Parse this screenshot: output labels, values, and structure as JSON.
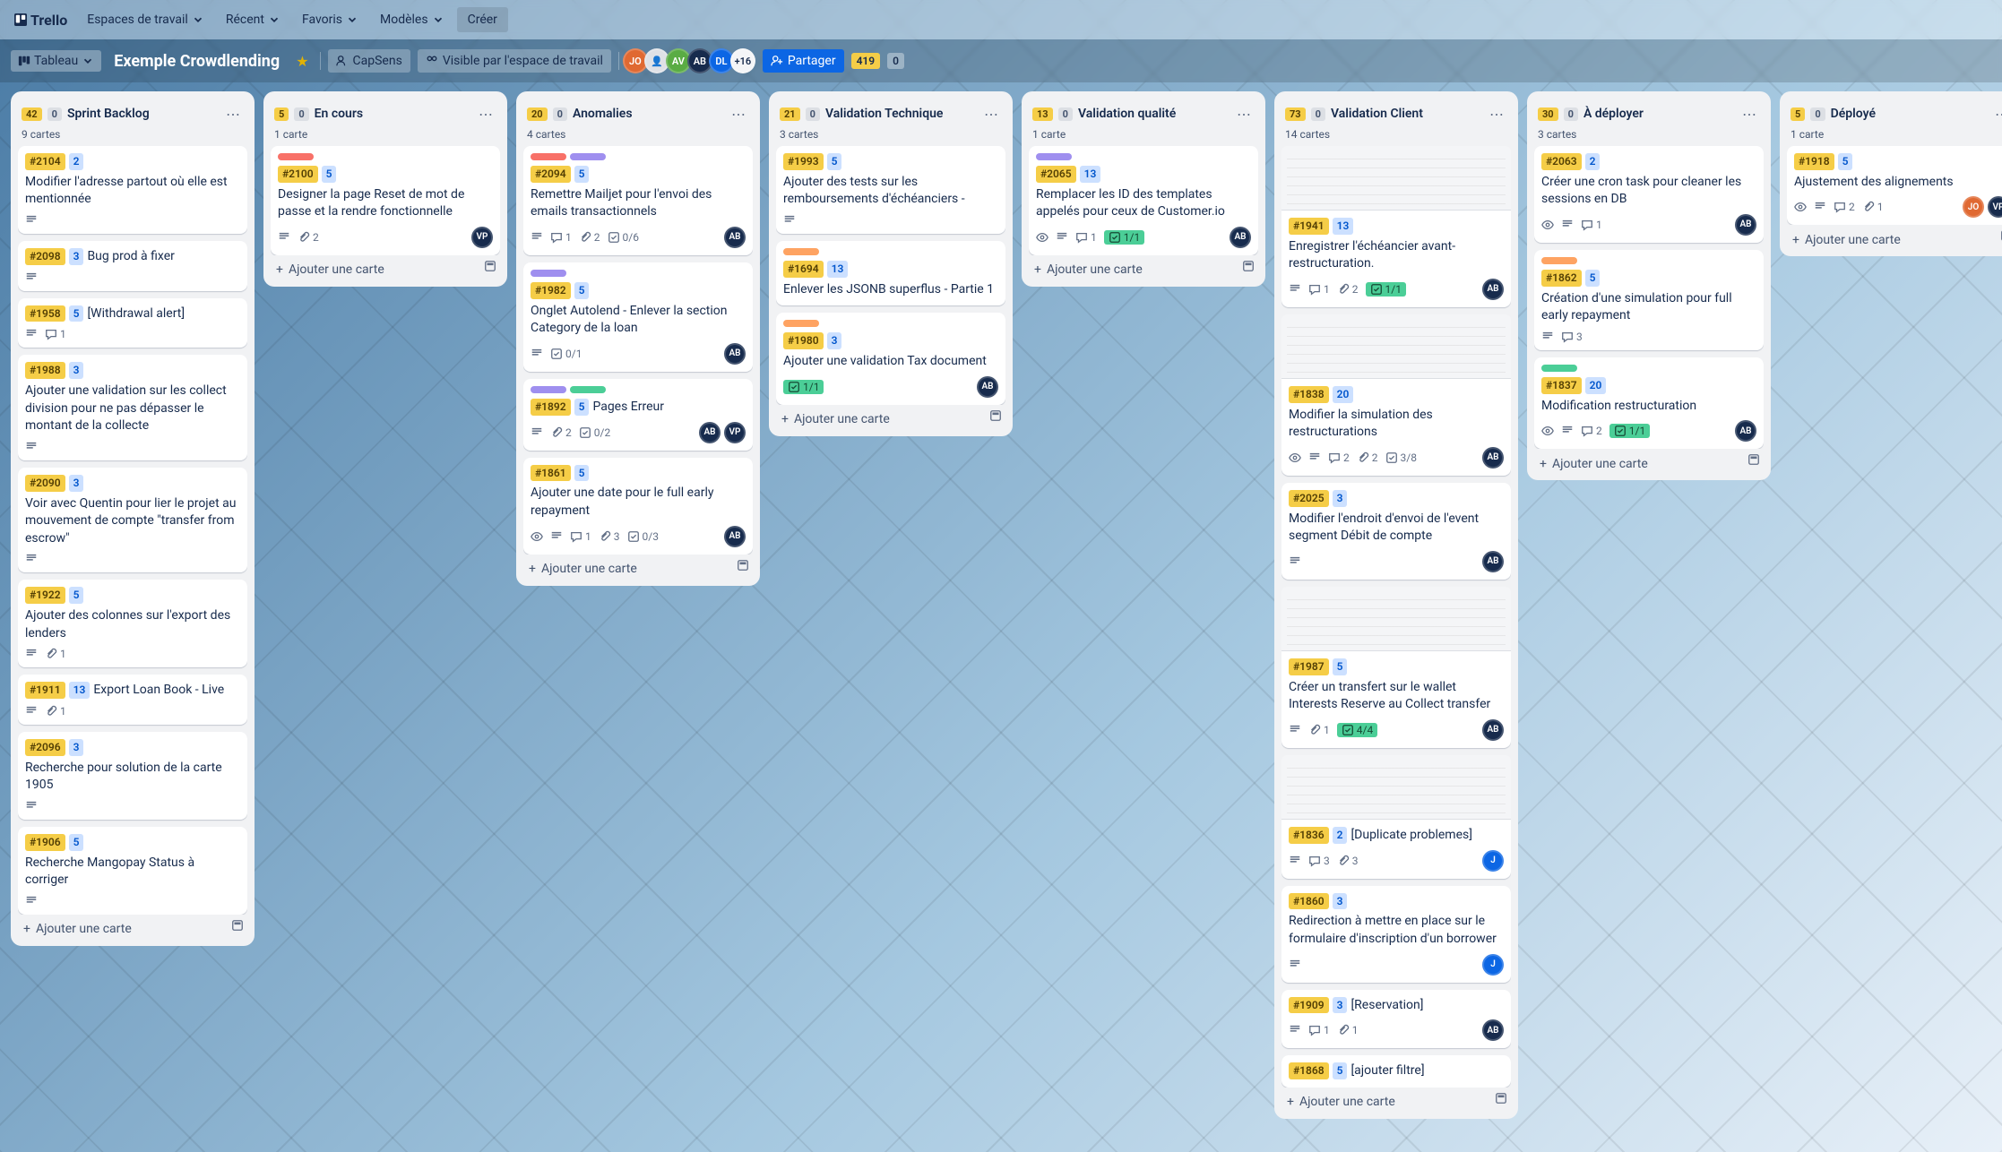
{
  "nav": {
    "brand": "Trello",
    "workspaces": "Espaces de travail",
    "recent": "Récent",
    "favorites": "Favoris",
    "templates": "Modèles",
    "create": "Créer"
  },
  "board_header": {
    "view_label": "Tableau",
    "board_name": "Exemple Crowdlending",
    "workspace_name": "CapSens",
    "visibility": "Visible par l'espace de travail",
    "share": "Partager",
    "avatars_more": "+16",
    "counter1": "419",
    "counter2": "0"
  },
  "add_card_label": "Ajouter une carte",
  "lists": [
    {
      "pill1": "42",
      "pill2": "0",
      "title": "Sprint Backlog",
      "sub": "9 cartes",
      "cards": [
        {
          "id": "#2104",
          "pts": "2",
          "title": "Modifier l'adresse partout où elle est mentionnée",
          "desc": true
        },
        {
          "id": "#2098",
          "pts": "3",
          "title": "Bug prod à fixer",
          "desc": true
        },
        {
          "id": "#1958",
          "pts": "5",
          "title": "[Withdrawal alert]",
          "desc": true,
          "comments": "1"
        },
        {
          "id": "#1988",
          "pts": "3",
          "title": "Ajouter une validation sur les collect division pour ne pas dépasser le montant de la collecte",
          "desc": true
        },
        {
          "id": "#2090",
          "pts": "3",
          "title": "Voir avec Quentin pour lier le projet au mouvement de compte \"transfer from escrow\"",
          "desc": true
        },
        {
          "id": "#1922",
          "pts": "5",
          "title": "Ajouter des colonnes sur l'export des lenders",
          "desc": true,
          "attach": "1"
        },
        {
          "id": "#1911",
          "pts": "13",
          "title": "Export Loan Book - Live",
          "desc": true,
          "attach": "1"
        },
        {
          "id": "#2096",
          "pts": "3",
          "title": "Recherche pour solution de la carte 1905",
          "desc": true
        },
        {
          "id": "#1906",
          "pts": "5",
          "title": "Recherche Mangopay Status à corriger",
          "desc": true
        }
      ]
    },
    {
      "pill1": "5",
      "pill2": "0",
      "title": "En cours",
      "sub": "1 carte",
      "cards": [
        {
          "labels": [
            "red"
          ],
          "id": "#2100",
          "pts": "5",
          "title": "Designer la page Reset de mot de passe et la rendre fonctionnelle",
          "desc": true,
          "attach": "2",
          "avatars": [
            "VP"
          ]
        }
      ]
    },
    {
      "pill1": "20",
      "pill2": "0",
      "title": "Anomalies",
      "sub": "4 cartes",
      "cards": [
        {
          "labels": [
            "red",
            "purple"
          ],
          "id": "#2094",
          "pts": "5",
          "title": "Remettre Mailjet pour l'envoi des emails transactionnels",
          "desc": true,
          "comments": "1",
          "attach": "2",
          "check": "0/6",
          "avatars": [
            "AB"
          ]
        },
        {
          "labels": [
            "purple"
          ],
          "id": "#1982",
          "pts": "5",
          "title": "Onglet Autolend - Enlever la section Category de la loan",
          "desc": true,
          "check": "0/1",
          "avatars": [
            "AB"
          ]
        },
        {
          "labels": [
            "purple",
            "green"
          ],
          "id": "#1892",
          "pts": "5",
          "title": "Pages Erreur",
          "desc": true,
          "attach": "2",
          "check": "0/2",
          "avatars": [
            "AB",
            "VP"
          ]
        },
        {
          "id": "#1861",
          "pts": "5",
          "title": "Ajouter une date pour le full early repayment",
          "watch": true,
          "desc": true,
          "comments": "1",
          "attach": "3",
          "check": "0/3",
          "avatars": [
            "AB"
          ]
        }
      ]
    },
    {
      "pill1": "21",
      "pill2": "0",
      "title": "Validation Technique",
      "sub": "3 cartes",
      "cards": [
        {
          "id": "#1993",
          "pts": "5",
          "title": "Ajouter des tests sur les remboursements d'échéanciers -",
          "desc": true
        },
        {
          "labels": [
            "orange"
          ],
          "id": "#1694",
          "pts": "13",
          "title": "Enlever les JSONB superflus - Partie 1"
        },
        {
          "labels": [
            "orange"
          ],
          "id": "#1980",
          "pts": "3",
          "title": "Ajouter une validation Tax document",
          "check": "1/1",
          "check_done": true,
          "avatars": [
            "AB"
          ]
        }
      ]
    },
    {
      "pill1": "13",
      "pill2": "0",
      "title": "Validation qualité",
      "sub": "1 carte",
      "cards": [
        {
          "labels": [
            "purple"
          ],
          "id": "#2065",
          "pts": "13",
          "title": "Remplacer les ID des templates appelés pour ceux de Customer.io",
          "watch": true,
          "desc": true,
          "comments": "1",
          "check": "1/1",
          "check_done": true,
          "avatars": [
            "AB"
          ]
        }
      ]
    },
    {
      "pill1": "73",
      "pill2": "0",
      "title": "Validation Client",
      "sub": "14 cartes",
      "cards": [
        {
          "cover": true,
          "id": "#1941",
          "pts": "13",
          "title": "Enregistrer l'échéancier avant-restructuration.",
          "desc": true,
          "comments": "1",
          "attach": "2",
          "check": "1/1",
          "check_done": true,
          "avatars": [
            "AB"
          ]
        },
        {
          "cover": true,
          "id": "#1838",
          "pts": "20",
          "title": "Modifier la simulation des restructurations",
          "watch": true,
          "desc": true,
          "comments": "2",
          "attach": "2",
          "check": "3/8",
          "avatars": [
            "AB"
          ]
        },
        {
          "id": "#2025",
          "pts": "3",
          "title": "Modifier l'endroit d'envoi de l'event segment Débit de compte",
          "desc": true,
          "avatars": [
            "AB"
          ]
        },
        {
          "cover": true,
          "id": "#1987",
          "pts": "5",
          "title": "Créer un transfert sur le wallet Interests Reserve au Collect transfer",
          "desc": true,
          "attach": "1",
          "check": "4/4",
          "check_done": true,
          "avatars": [
            "AB"
          ]
        },
        {
          "cover": true,
          "id": "#1836",
          "pts": "2",
          "title": "[Duplicate problemes]",
          "desc": true,
          "comments": "3",
          "attach": "3",
          "avatars": [
            "J"
          ]
        },
        {
          "id": "#1860",
          "pts": "3",
          "title": "Redirection à mettre en place sur le formulaire d'inscription d'un borrower",
          "desc": true,
          "avatars": [
            "J"
          ]
        },
        {
          "id": "#1909",
          "pts": "3",
          "title": "[Reservation]",
          "desc": true,
          "comments": "1",
          "attach": "1",
          "avatars": [
            "AB"
          ]
        },
        {
          "id": "#1868",
          "pts": "5",
          "title": "[ajouter filtre]"
        }
      ]
    },
    {
      "pill1": "30",
      "pill2": "0",
      "title": "À déployer",
      "sub": "3 cartes",
      "cards": [
        {
          "id": "#2063",
          "pts": "2",
          "title": "Créer une cron task pour cleaner les sessions en DB",
          "watch": true,
          "desc": true,
          "comments": "1",
          "avatars": [
            "AB"
          ]
        },
        {
          "labels": [
            "orange"
          ],
          "id": "#1862",
          "pts": "5",
          "title": "Création d'une simulation pour full early repayment",
          "desc": true,
          "comments": "3"
        },
        {
          "labels": [
            "green"
          ],
          "id": "#1837",
          "pts": "20",
          "title": "Modification restructuration",
          "watch": true,
          "desc": true,
          "comments": "2",
          "check": "1/1",
          "check_done": true,
          "avatars": [
            "AB"
          ]
        }
      ]
    },
    {
      "pill1": "5",
      "pill2": "0",
      "title": "Déployé",
      "sub": "1 carte",
      "cards": [
        {
          "id": "#1918",
          "pts": "5",
          "title": "Ajustement des alignements",
          "watch": true,
          "desc": true,
          "comments": "2",
          "attach": "1",
          "avatars": [
            "JO",
            "VP"
          ]
        }
      ]
    }
  ]
}
